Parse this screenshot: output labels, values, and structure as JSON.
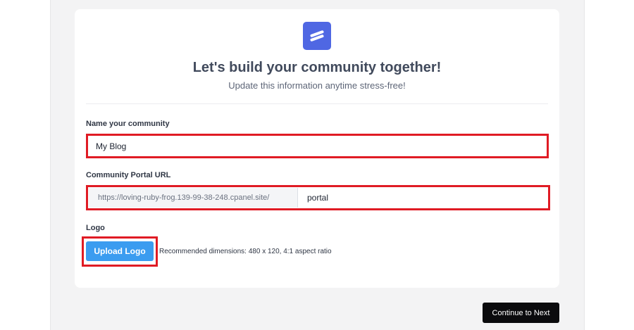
{
  "header": {
    "logo_icon": "stripes-logo-icon",
    "title": "Let's build your community together!",
    "subtitle": "Update this information anytime stress-free!"
  },
  "form": {
    "name_label": "Name your community",
    "name_value": "My Blog",
    "url_label": "Community Portal URL",
    "url_prefix": "https://loving-ruby-frog.139-99-38-248.cpanel.site/",
    "url_value": "portal",
    "logo_label": "Logo",
    "upload_button": "Upload Logo",
    "logo_hint": "Recommended dimensions: 480 x 120, 4:1 aspect ratio"
  },
  "footer": {
    "next_button": "Continue to Next"
  },
  "colors": {
    "brand": "#4f67e3",
    "upload_button": "#3b9cf0",
    "highlight": "#e01b24",
    "next_button": "#0b0b0d"
  }
}
